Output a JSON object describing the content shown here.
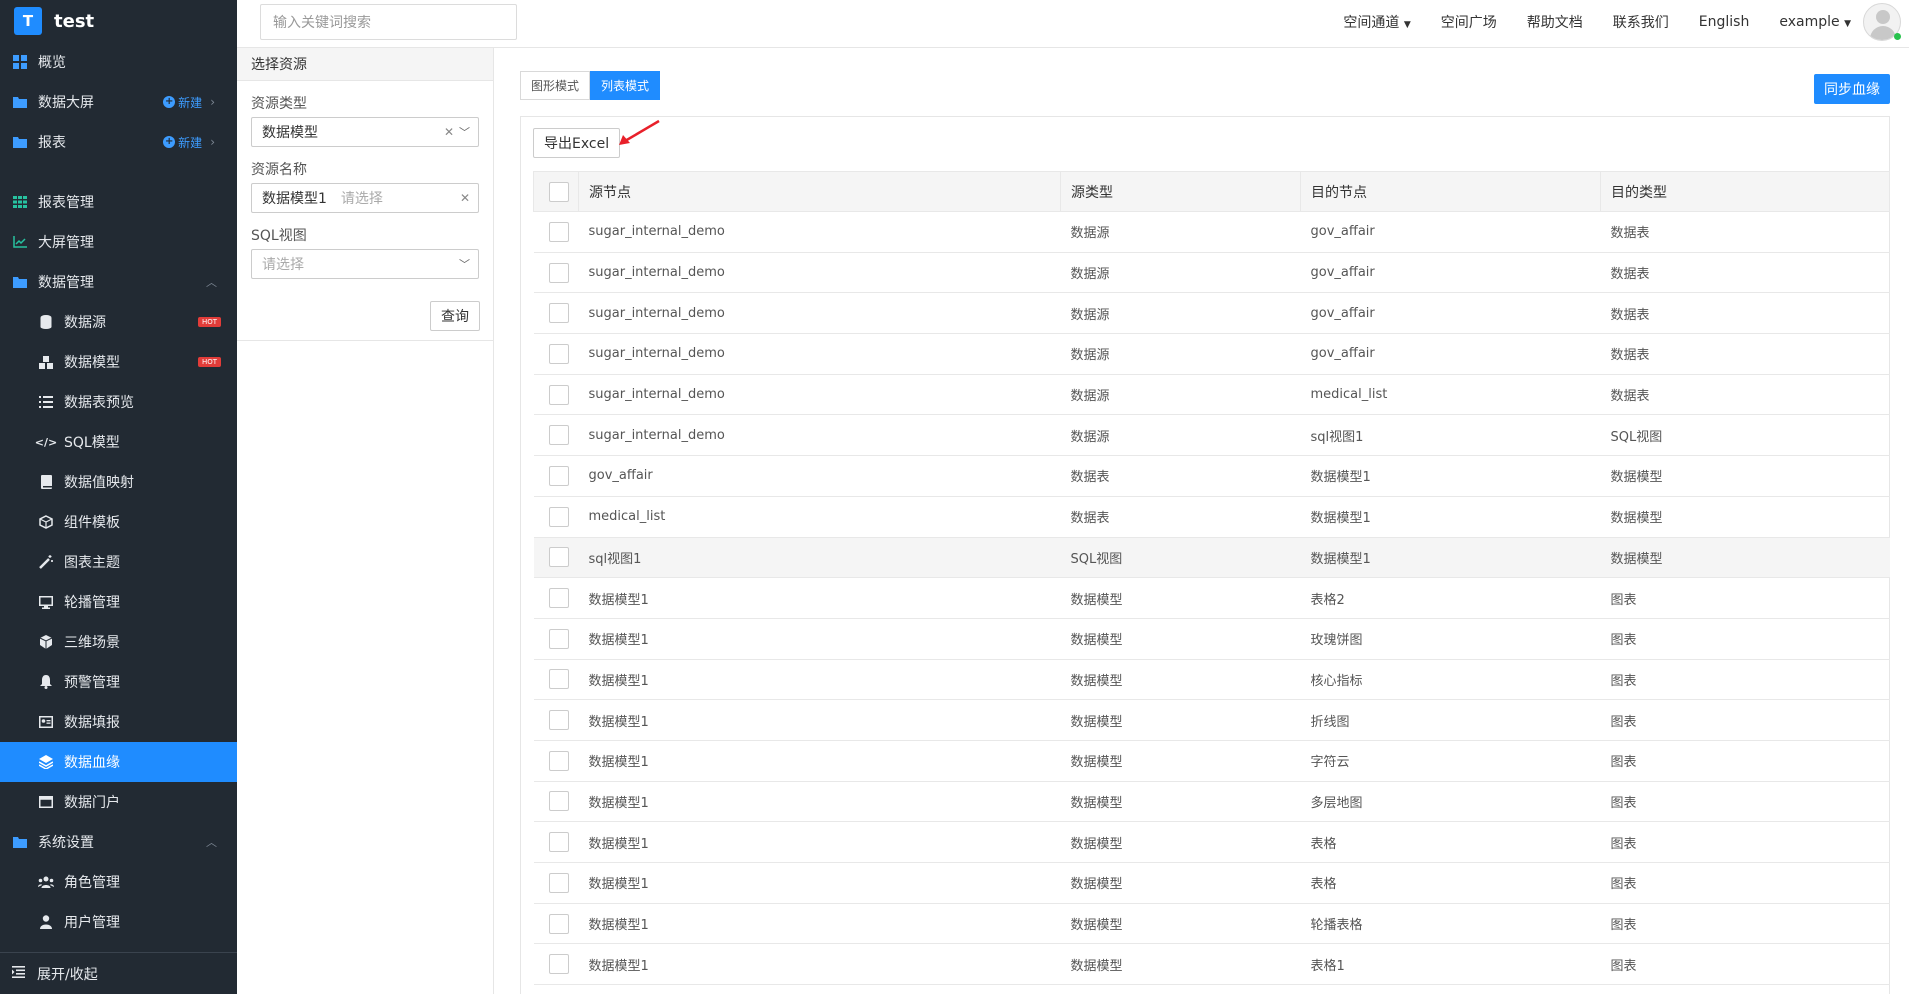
{
  "app": {
    "logo_letter": "T",
    "name": "test"
  },
  "sidebar": {
    "new_label": "新建",
    "hot_label": "HOT",
    "items": [
      {
        "label": "概览"
      },
      {
        "label": "数据大屏"
      },
      {
        "label": "报表"
      },
      {
        "label": "报表管理"
      },
      {
        "label": "大屏管理"
      },
      {
        "label": "数据管理"
      },
      {
        "label": "数据源"
      },
      {
        "label": "数据模型"
      },
      {
        "label": "数据表预览"
      },
      {
        "label": "SQL模型"
      },
      {
        "label": "数据值映射"
      },
      {
        "label": "组件模板"
      },
      {
        "label": "图表主题"
      },
      {
        "label": "轮播管理"
      },
      {
        "label": "三维场景"
      },
      {
        "label": "预警管理"
      },
      {
        "label": "数据填报"
      },
      {
        "label": "数据血缘"
      },
      {
        "label": "数据门户"
      },
      {
        "label": "系统设置"
      },
      {
        "label": "角色管理"
      },
      {
        "label": "用户管理"
      }
    ],
    "footer": "展开/收起"
  },
  "topbar": {
    "search_placeholder": "输入关键词搜索",
    "nav": [
      "空间通道",
      "空间广场",
      "帮助文档",
      "联系我们",
      "English",
      "example"
    ]
  },
  "panel": {
    "title": "选择资源",
    "resource_type_label": "资源类型",
    "resource_type_value": "数据模型",
    "resource_name_label": "资源名称",
    "resource_name_value": "数据模型1",
    "resource_name_placeholder": "请选择",
    "sql_view_label": "SQL视图",
    "sql_view_placeholder": "请选择",
    "query_button": "查询"
  },
  "main": {
    "mode_graph": "图形模式",
    "mode_list": "列表模式",
    "sync_button": "同步血缘",
    "export_button": "导出Excel",
    "columns": [
      "源节点",
      "源类型",
      "目的节点",
      "目的类型"
    ],
    "rows": [
      [
        "sugar_internal_demo",
        "数据源",
        "gov_affair",
        "数据表"
      ],
      [
        "sugar_internal_demo",
        "数据源",
        "gov_affair",
        "数据表"
      ],
      [
        "sugar_internal_demo",
        "数据源",
        "gov_affair",
        "数据表"
      ],
      [
        "sugar_internal_demo",
        "数据源",
        "gov_affair",
        "数据表"
      ],
      [
        "sugar_internal_demo",
        "数据源",
        "medical_list",
        "数据表"
      ],
      [
        "sugar_internal_demo",
        "数据源",
        "sql视图1",
        "SQL视图"
      ],
      [
        "gov_affair",
        "数据表",
        "数据模型1",
        "数据模型"
      ],
      [
        "medical_list",
        "数据表",
        "数据模型1",
        "数据模型"
      ],
      [
        "sql视图1",
        "SQL视图",
        "数据模型1",
        "数据模型"
      ],
      [
        "数据模型1",
        "数据模型",
        "表格2",
        "图表"
      ],
      [
        "数据模型1",
        "数据模型",
        "玫瑰饼图",
        "图表"
      ],
      [
        "数据模型1",
        "数据模型",
        "核心指标",
        "图表"
      ],
      [
        "数据模型1",
        "数据模型",
        "折线图",
        "图表"
      ],
      [
        "数据模型1",
        "数据模型",
        "字符云",
        "图表"
      ],
      [
        "数据模型1",
        "数据模型",
        "多层地图",
        "图表"
      ],
      [
        "数据模型1",
        "数据模型",
        "表格",
        "图表"
      ],
      [
        "数据模型1",
        "数据模型",
        "表格",
        "图表"
      ],
      [
        "数据模型1",
        "数据模型",
        "轮播表格",
        "图表"
      ],
      [
        "数据模型1",
        "数据模型",
        "表格1",
        "图表"
      ]
    ]
  },
  "colors": {
    "accent": "#1f8cff",
    "sidebar_bg": "#222a33",
    "hot": "#e23c39",
    "arrow": "#e8202a"
  }
}
